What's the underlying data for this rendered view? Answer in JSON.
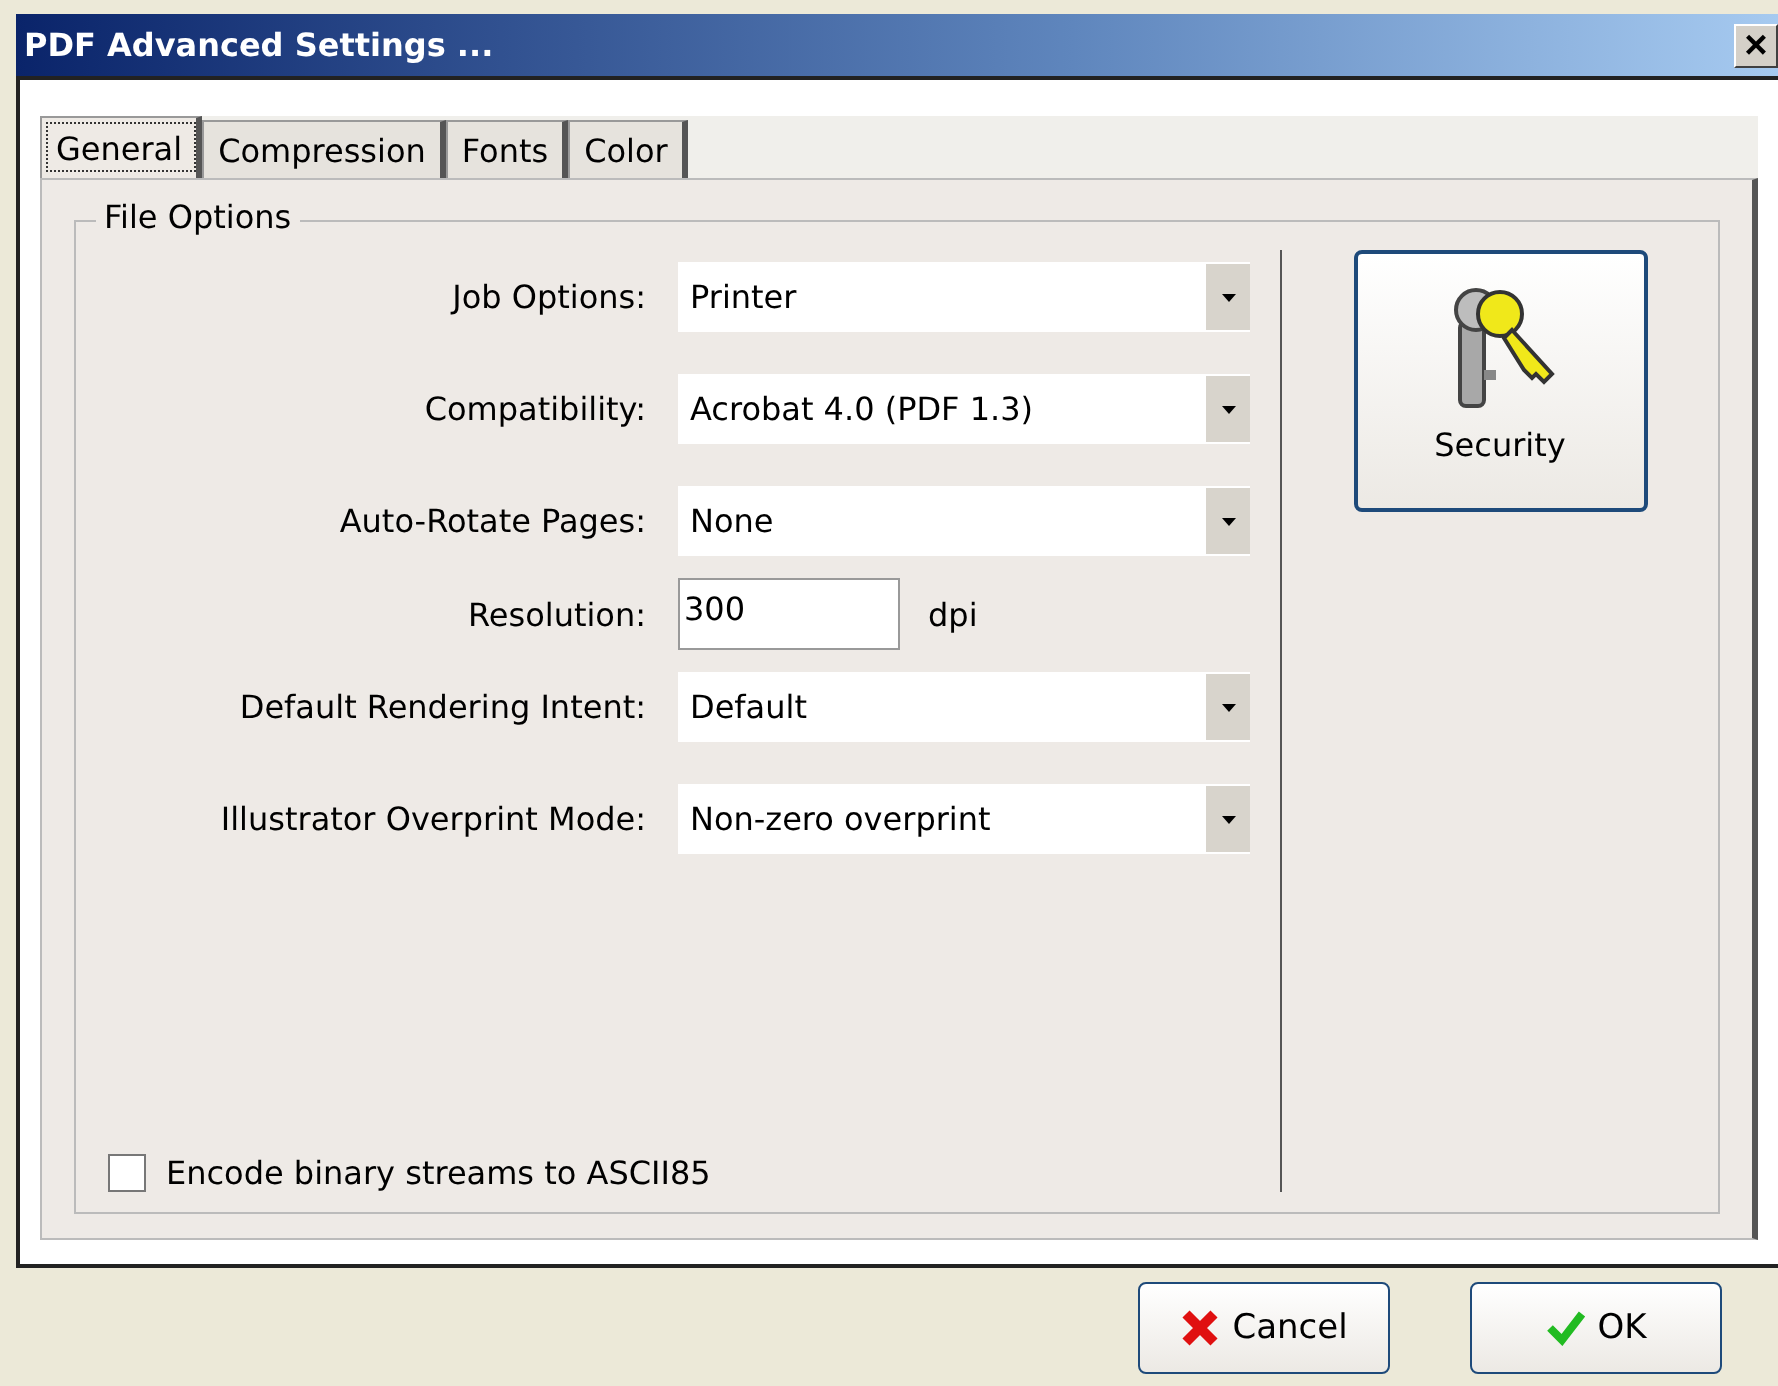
{
  "window": {
    "title": "PDF Advanced Settings ...",
    "close": "×"
  },
  "tabs": [
    {
      "label": "General",
      "selected": true
    },
    {
      "label": "Compression",
      "selected": false
    },
    {
      "label": "Fonts",
      "selected": false
    },
    {
      "label": "Color",
      "selected": false
    }
  ],
  "group": {
    "title": "File Options",
    "fields": [
      {
        "kind": "dropdown",
        "label": "Job Options:",
        "value": "Printer"
      },
      {
        "kind": "dropdown",
        "label": "Compatibility:",
        "value": "Acrobat 4.0 (PDF 1.3)"
      },
      {
        "kind": "dropdown",
        "label": "Auto-Rotate Pages:",
        "value": "None"
      },
      {
        "kind": "text",
        "label": "Resolution:",
        "value": "300",
        "unit": "dpi"
      },
      {
        "kind": "dropdown",
        "label": "Default Rendering Intent:",
        "value": "Default"
      },
      {
        "kind": "dropdown",
        "label": "Illustrator Overprint Mode:",
        "value": "Non-zero overprint"
      }
    ],
    "checkbox": {
      "label": "Encode binary streams to ASCII85",
      "checked": false
    }
  },
  "security_button": "Security",
  "buttons": [
    {
      "kind": "cancel",
      "label": "Cancel"
    },
    {
      "kind": "ok",
      "label": "OK"
    }
  ]
}
